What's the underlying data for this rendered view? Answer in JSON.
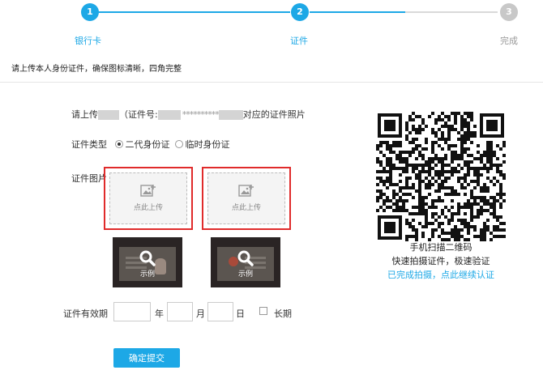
{
  "stepper": {
    "steps": [
      {
        "number": "1",
        "label": "银行卡"
      },
      {
        "number": "2",
        "label": "证件"
      },
      {
        "number": "3",
        "label": "完成"
      }
    ]
  },
  "instruction": "请上传本人身份证件，确保图标清晰，四角完整",
  "prompt": {
    "prefix": "请上传",
    "middle": "（证件号:",
    "stars": "**********",
    "suffix": "对应的证件照片"
  },
  "id_type": {
    "label": "证件类型",
    "options": [
      {
        "label": "二代身份证",
        "selected": true
      },
      {
        "label": "临时身份证",
        "selected": false
      }
    ]
  },
  "photo": {
    "label": "证件图片",
    "upload_text": "点此上传",
    "sample_text": "示例"
  },
  "validity": {
    "label": "证件有效期",
    "year_value": "",
    "year_unit": "年",
    "month_value": "",
    "month_unit": "月",
    "day_value": "",
    "day_unit": "日",
    "long_term_label": "长期",
    "long_term_checked": false
  },
  "submit_label": "确定提交",
  "qr": {
    "caption1": "手机扫描二维码",
    "caption2": "快速拍摄证件，极速验证",
    "link": "已完成拍摄，点此继续认证"
  },
  "colors": {
    "accent": "#1da8e6",
    "highlight_border": "#e02b2b",
    "inactive_step": "#c8c8c8"
  }
}
